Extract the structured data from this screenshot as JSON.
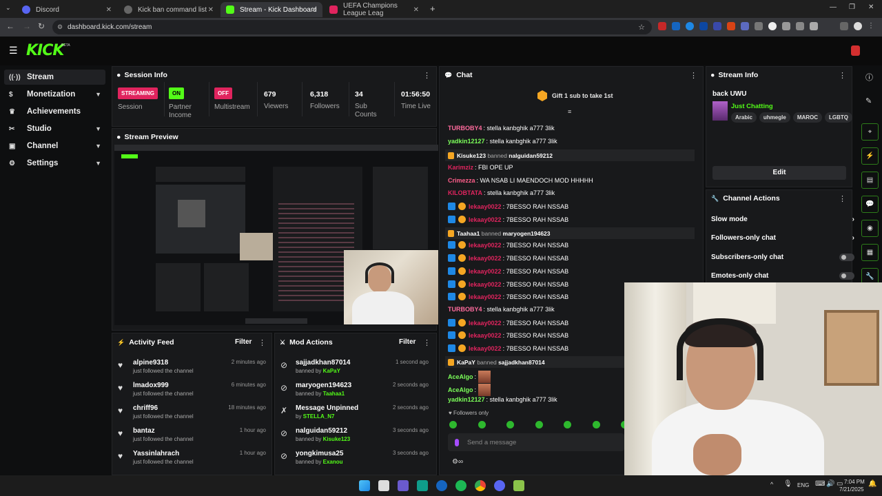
{
  "browser": {
    "tabs": [
      {
        "title": "Discord",
        "color": "#5865f2"
      },
      {
        "title": "Kick ban command list",
        "color": "#888888"
      },
      {
        "title": "Stream - Kick Dashboard",
        "color": "#53fc18"
      },
      {
        "title": "UEFA Champions League Leag",
        "color": "#e0245e"
      }
    ],
    "url": "dashboard.kick.com/stream"
  },
  "app": {
    "logo": "KICK",
    "beta": "BETA"
  },
  "sidebar": {
    "items": [
      {
        "label": "Stream",
        "icon": "broadcast-icon"
      },
      {
        "label": "Monetization",
        "icon": "dollar-icon"
      },
      {
        "label": "Achievements",
        "icon": "trophy-icon"
      },
      {
        "label": "Studio",
        "icon": "tools-icon"
      },
      {
        "label": "Channel",
        "icon": "channel-icon"
      },
      {
        "label": "Settings",
        "icon": "gear-icon"
      }
    ]
  },
  "session": {
    "title": "Session Info",
    "streaming_badge": "STREAMING",
    "session_label": "Session",
    "on_badge": "ON",
    "partner_label": "Partner Income",
    "off_badge": "OFF",
    "multistream_label": "Multistream",
    "viewers": "679",
    "viewers_label": "Viewers",
    "followers": "6,318",
    "followers_label": "Followers",
    "subs": "34",
    "subs_label": "Sub Counts",
    "time": "01:56:50",
    "time_label": "Time Live"
  },
  "preview": {
    "title": "Stream Preview"
  },
  "activity": {
    "title": "Activity Feed",
    "filter": "Filter",
    "items": [
      {
        "name": "alpine9318",
        "sub": "just followed the channel",
        "time": "2 minutes ago"
      },
      {
        "name": "lmadox999",
        "sub": "just followed the channel",
        "time": "6 minutes ago"
      },
      {
        "name": "chriff96",
        "sub": "just followed the channel",
        "time": "18 minutes ago"
      },
      {
        "name": "bantaz",
        "sub": "just followed the channel",
        "time": "1 hour ago"
      },
      {
        "name": "Yassinlahrach",
        "sub": "just followed the channel",
        "time": "1 hour ago"
      }
    ]
  },
  "modactions": {
    "title": "Mod Actions",
    "filter": "Filter",
    "items": [
      {
        "name": "sajjadkhan87014",
        "sub_prefix": "banned by",
        "by": "KaPaY",
        "time": "1 second ago"
      },
      {
        "name": "maryogen194623",
        "sub_prefix": "banned by",
        "by": "Taahaa1",
        "time": "2 seconds ago"
      },
      {
        "name": "Message Unpinned",
        "sub_prefix": "by",
        "by": "STELLA_N7",
        "time": "2 seconds ago"
      },
      {
        "name": "nalguidan59212",
        "sub_prefix": "banned by",
        "by": "Kisuke123",
        "time": "3 seconds ago"
      },
      {
        "name": "yongkimusa25",
        "sub_prefix": "banned by",
        "by": "Exanou",
        "time": "3 seconds ago"
      }
    ]
  },
  "chat": {
    "title": "Chat",
    "gift": "Gift 1 sub to take 1st",
    "lines": [
      {
        "user": "TURBOBY4",
        "color": "#ff6b9d",
        "msg": "stella kanbghik a777 3lik",
        "badges": 0
      },
      {
        "user": "yadkin12127",
        "color": "#7cff5a",
        "msg": "stella kanbghik a777 3lik",
        "badges": 0
      },
      {
        "mod": true,
        "actor": "Kisuke123",
        "action": "banned",
        "target": "nalguidan59212"
      },
      {
        "user": "Karimziz",
        "color": "#e0245e",
        "msg": "FBI OPE UP",
        "badges": 0
      },
      {
        "user": "Crimezza",
        "color": "#ff5e8a",
        "msg": "WA NSAB LI MAENDOCH MOD HHHHH",
        "badges": 0
      },
      {
        "user": "KILOBTATA",
        "color": "#e0245e",
        "msg": "stella kanbghik a777 3lik",
        "badges": 0
      },
      {
        "user": "lekaay0022",
        "color": "#e0245e",
        "msg": "7BESSO RAH NSSAB",
        "badges": 2
      },
      {
        "user": "lekaay0022",
        "color": "#e0245e",
        "msg": "7BESSO RAH NSSAB",
        "badges": 2
      },
      {
        "mod": true,
        "actor": "Taahaa1",
        "action": "banned",
        "target": "maryogen194623"
      },
      {
        "user": "lekaay0022",
        "color": "#e0245e",
        "msg": "7BESSO RAH NSSAB",
        "badges": 2
      },
      {
        "user": "lekaay0022",
        "color": "#e0245e",
        "msg": "7BESSO RAH NSSAB",
        "badges": 2
      },
      {
        "user": "lekaay0022",
        "color": "#e0245e",
        "msg": "7BESSO RAH NSSAB",
        "badges": 2
      },
      {
        "user": "lekaay0022",
        "color": "#e0245e",
        "msg": "7BESSO RAH NSSAB",
        "badges": 2
      },
      {
        "user": "lekaay0022",
        "color": "#e0245e",
        "msg": "7BESSO RAH NSSAB",
        "badges": 2
      },
      {
        "user": "TURBOBY4",
        "color": "#ff6b9d",
        "msg": "stella kanbghik a777 3lik",
        "badges": 0
      },
      {
        "user": "lekaay0022",
        "color": "#e0245e",
        "msg": "7BESSO RAH NSSAB",
        "badges": 2
      },
      {
        "user": "lekaay0022",
        "color": "#e0245e",
        "msg": "7BESSO RAH NSSAB",
        "badges": 2
      },
      {
        "user": "lekaay0022",
        "color": "#e0245e",
        "msg": "7BESSO RAH NSSAB",
        "badges": 2
      },
      {
        "mod": true,
        "actor": "KaPaY",
        "action": "banned",
        "target": "sajjadkhan87014"
      },
      {
        "user": "AceAlgo",
        "color": "#7cff5a",
        "msg": "",
        "badges": 0,
        "emote": true
      },
      {
        "user": "AceAlgo",
        "color": "#7cff5a",
        "msg": "",
        "badges": 0,
        "emote": true
      },
      {
        "user": "yadkin12127",
        "color": "#7cff5a",
        "msg": "stella kanbghik a777 3lik",
        "badges": 0
      }
    ],
    "followers_only": "Followers only",
    "placeholder": "Send a message"
  },
  "streaminfo": {
    "title": "Stream Info",
    "stream_title": "back UWU",
    "category": "Just Chatting",
    "tags": [
      "Arabic",
      "uhmegle",
      "MAROC",
      "LGBTQ"
    ],
    "edit": "Edit"
  },
  "channelactions": {
    "title": "Channel Actions",
    "items": [
      "Slow mode",
      "Followers-only chat",
      "Subscribers-only chat",
      "Emotes-only chat"
    ]
  },
  "taskbar": {
    "lang": "ENG",
    "time": "7:04 PM",
    "date": "7/21/2025"
  }
}
